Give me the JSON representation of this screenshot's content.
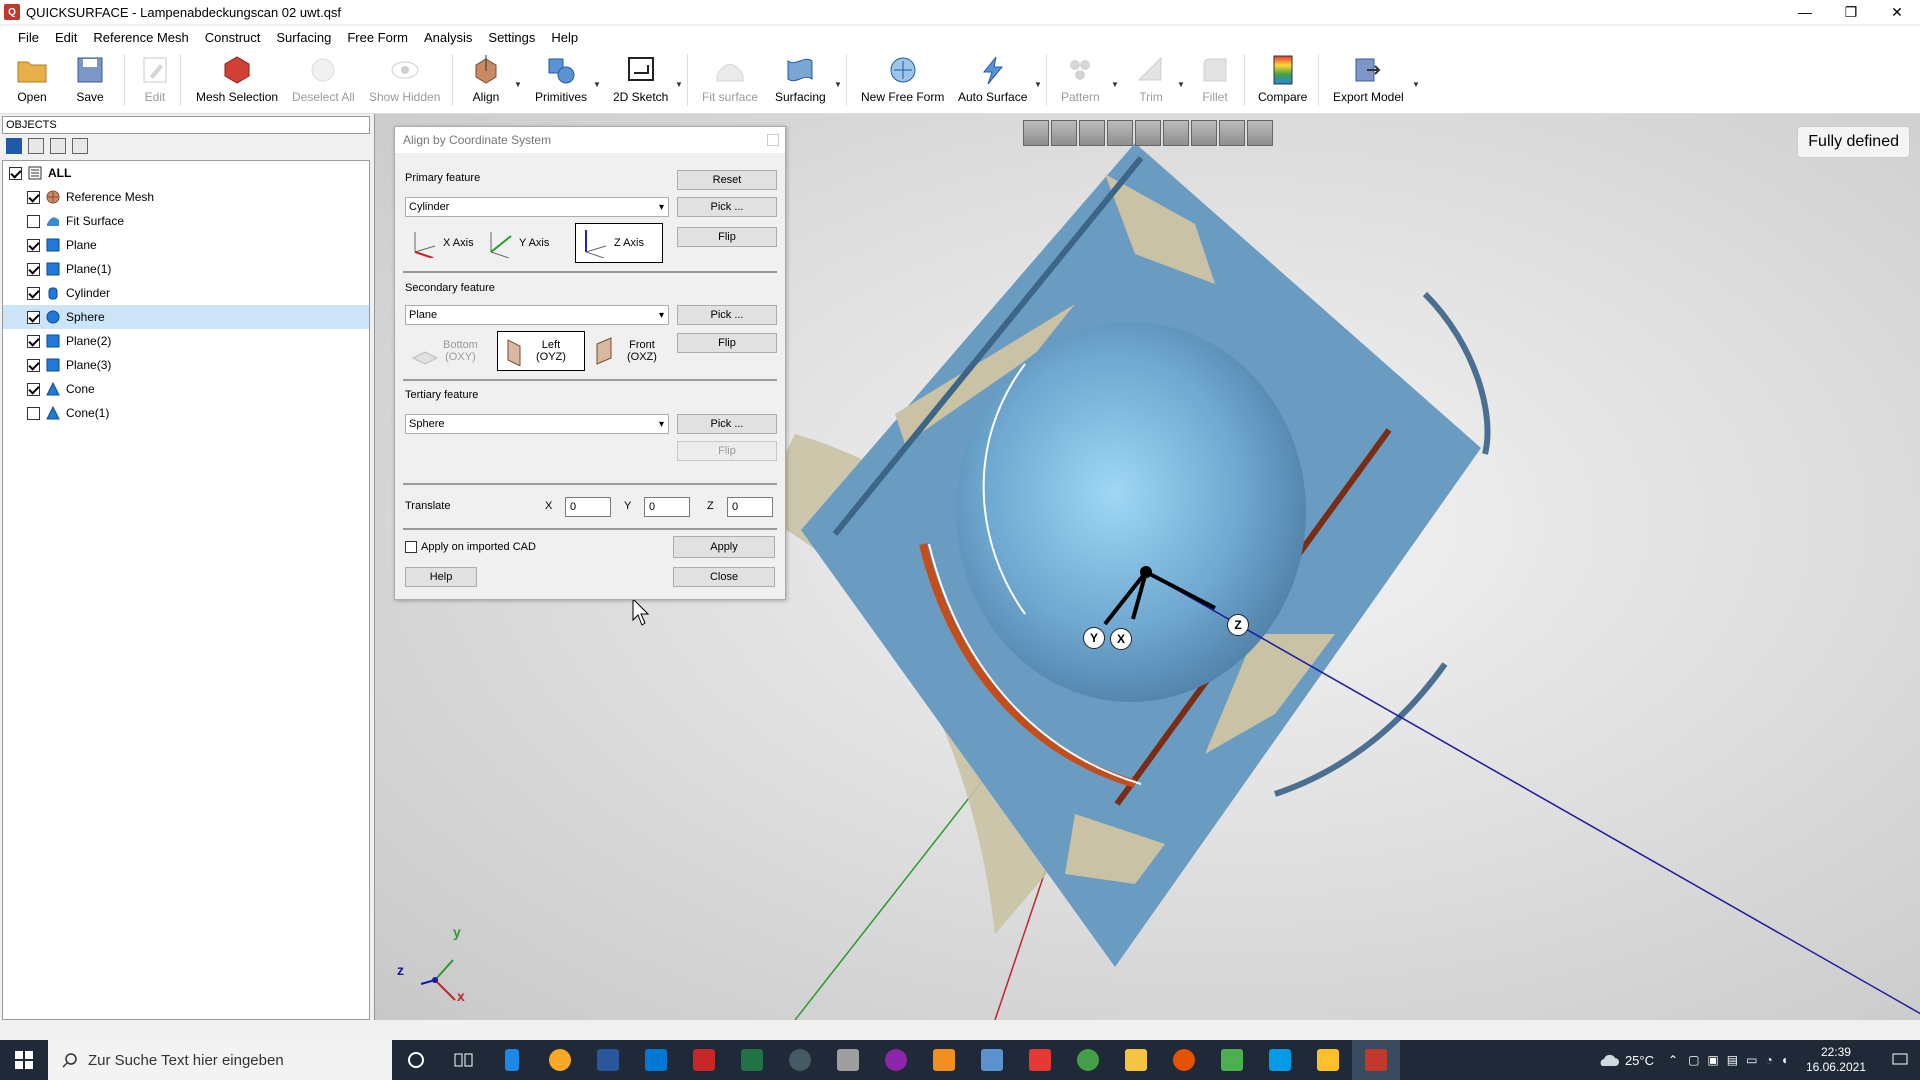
{
  "window": {
    "title": "QUICKSURFACE - Lampenabdeckungscan 02 uwt.qsf",
    "controls": [
      "—",
      "❐",
      "✕"
    ]
  },
  "menu": [
    "File",
    "Edit",
    "Reference Mesh",
    "Construct",
    "Surfacing",
    "Free Form",
    "Analysis",
    "Settings",
    "Help"
  ],
  "toolbar": {
    "open": "Open",
    "save": "Save",
    "edit": "Edit",
    "mesh_selection": "Mesh Selection",
    "deselect_all": "Deselect All",
    "show_hidden": "Show Hidden",
    "align": "Align",
    "primitives": "Primitives",
    "sketch_2d": "2D Sketch",
    "fit_surface": "Fit surface",
    "surfacing": "Surfacing",
    "new_free_form": "New Free Form",
    "auto_surface": "Auto Surface",
    "pattern": "Pattern",
    "trim": "Trim",
    "fillet": "Fillet",
    "compare": "Compare",
    "export_model": "Export Model"
  },
  "objects": {
    "header": "OBJECTS",
    "root": "ALL",
    "items": [
      {
        "label": "Reference Mesh",
        "checked": true,
        "icon": "mesh-icon"
      },
      {
        "label": "Fit Surface",
        "checked": false,
        "icon": "surface-icon"
      },
      {
        "label": "Plane",
        "checked": true,
        "icon": "plane-icon"
      },
      {
        "label": "Plane(1)",
        "checked": true,
        "icon": "plane-icon"
      },
      {
        "label": "Cylinder",
        "checked": true,
        "icon": "cylinder-icon"
      },
      {
        "label": "Sphere",
        "checked": true,
        "icon": "sphere-icon",
        "selected": true
      },
      {
        "label": "Plane(2)",
        "checked": true,
        "icon": "plane-icon"
      },
      {
        "label": "Plane(3)",
        "checked": true,
        "icon": "plane-icon"
      },
      {
        "label": "Cone",
        "checked": true,
        "icon": "cone-icon"
      },
      {
        "label": "Cone(1)",
        "checked": false,
        "icon": "cone-icon"
      }
    ]
  },
  "dialog": {
    "title": "Align by Coordinate System",
    "primary_label": "Primary feature",
    "primary_value": "Cylinder",
    "secondary_label": "Secondary feature",
    "secondary_value": "Plane",
    "tertiary_label": "Tertiary feature",
    "tertiary_value": "Sphere",
    "reset": "Reset",
    "pick": "Pick ...",
    "flip": "Flip",
    "x_axis": "X Axis",
    "y_axis": "Y Axis",
    "z_axis": "Z Axis",
    "bottom": "Bottom",
    "bottom_sub": "(OXY)",
    "left": "Left",
    "left_sub": "(OYZ)",
    "front": "Front",
    "front_sub": "(OXZ)",
    "translate": "Translate",
    "tx_label": "X",
    "ty_label": "Y",
    "tz_label": "Z",
    "tx": "0",
    "ty": "0",
    "tz": "0",
    "apply_imported": "Apply on imported CAD",
    "apply": "Apply",
    "help": "Help",
    "close": "Close"
  },
  "viewport": {
    "status": "Fully defined",
    "gizmo_labels": {
      "y": "Y",
      "x": "X",
      "z": "Z"
    },
    "triad": {
      "x": "x",
      "y": "y",
      "z": "z"
    }
  },
  "taskbar": {
    "search_placeholder": "Zur Suche Text hier eingeben",
    "temperature": "25°C",
    "time": "22:39",
    "date": "16.06.2021"
  },
  "colors": {
    "accent": "#1e5aa8",
    "selection": "#cce4f7",
    "plane": "#6a9cc2",
    "sphere": "#7ab8e0",
    "mesh": "#c9c2a4",
    "orange": "#c44d1c"
  }
}
